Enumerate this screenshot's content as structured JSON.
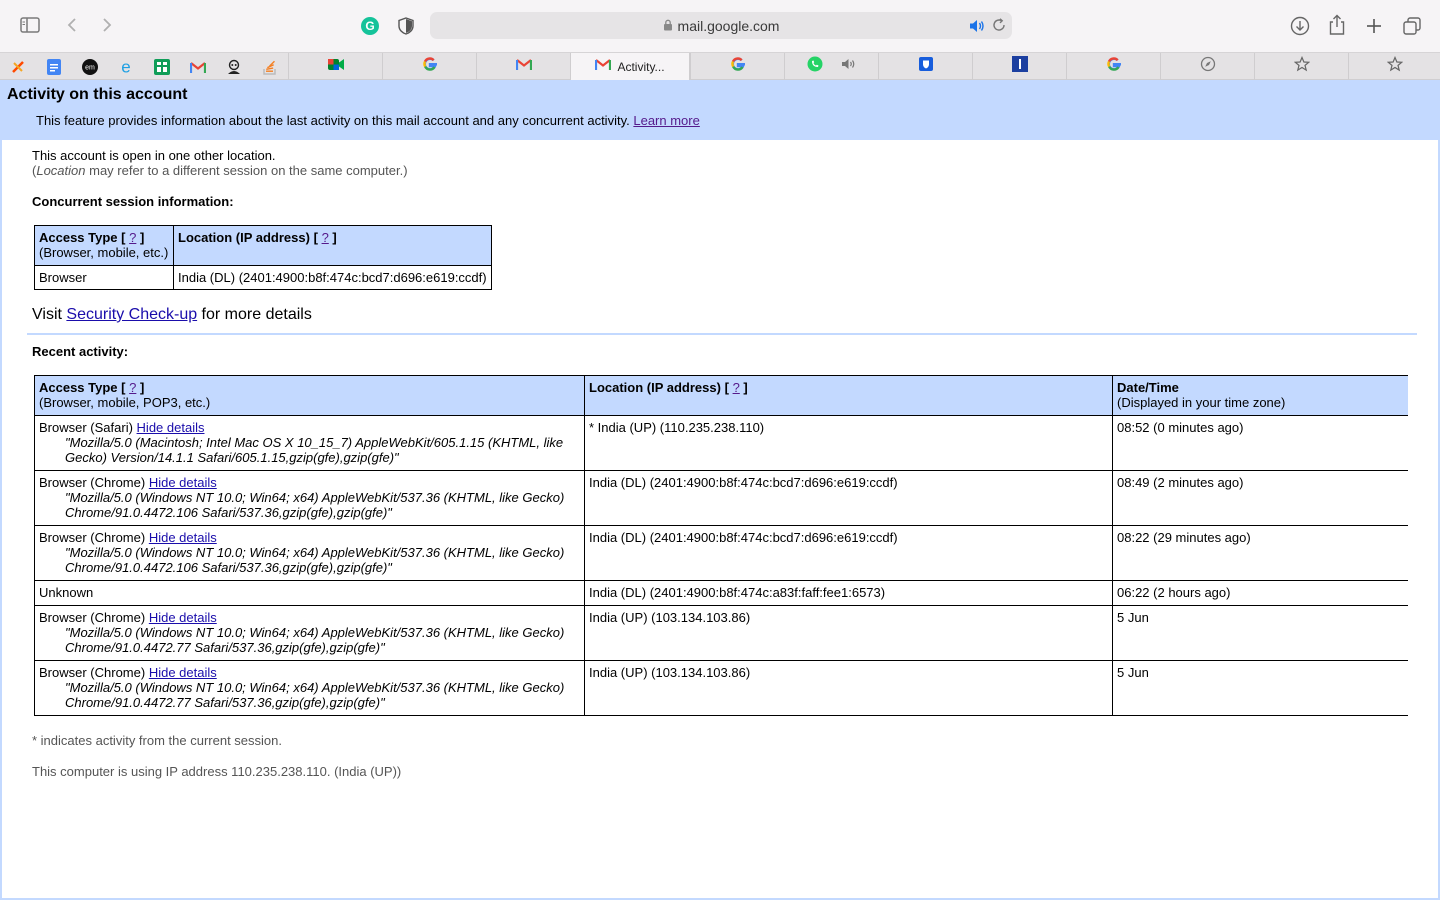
{
  "browser": {
    "url": "mail.google.com",
    "active_tab_title": "Activity...",
    "accent": "#1a73e8"
  },
  "page": {
    "title": "Activity on this account",
    "intro": "This feature provides information about the last activity on this mail account and any concurrent activity.",
    "learn_more": "Learn more",
    "open_status": "This account is open in one other location.",
    "location_note_pre": "(",
    "location_note_em": "Location",
    "location_note_post": " may refer to a different session on the same computer.)",
    "concurrent_heading": "Concurrent session information:",
    "visit_pre": "Visit ",
    "security_link": "Security Check-up",
    "visit_post": " for more details",
    "recent_heading": "Recent activity:",
    "footnote_current": "* indicates activity from the current session.",
    "footnote_ip": "This computer is using IP address 110.235.238.110. (India (UP))",
    "help_mark": "?",
    "bracket_open": "[",
    "bracket_close": "]"
  },
  "concurrent_table": {
    "col1_title": "Access Type",
    "col1_sub": "(Browser, mobile, etc.)",
    "col2_title": "Location (IP address)",
    "rows": [
      {
        "access": "Browser",
        "location": "India (DL) (2401:4900:b8f:474c:bcd7:d696:e619:ccdf)"
      }
    ]
  },
  "recent_table": {
    "col1_title": "Access Type",
    "col1_sub": "(Browser, mobile, POP3, etc.)",
    "col2_title": "Location (IP address)",
    "col3_title": "Date/Time",
    "col3_sub": "(Displayed in your time zone)",
    "hide_details": "Hide details",
    "rows": [
      {
        "access": "Browser (Safari)",
        "details": true,
        "ua": "\"Mozilla/5.0 (Macintosh; Intel Mac OS X 10_15_7) AppleWebKit/605.1.15 (KHTML, like Gecko) Version/14.1.1 Safari/605.1.15,gzip(gfe),gzip(gfe)\"",
        "location": "* India (UP) (110.235.238.110)",
        "time": "08:52 (0 minutes ago)"
      },
      {
        "access": "Browser (Chrome)",
        "details": true,
        "ua": "\"Mozilla/5.0 (Windows NT 10.0; Win64; x64) AppleWebKit/537.36 (KHTML, like Gecko) Chrome/91.0.4472.106 Safari/537.36,gzip(gfe),gzip(gfe)\"",
        "location": "India (DL) (2401:4900:b8f:474c:bcd7:d696:e619:ccdf)",
        "time": "08:49 (2 minutes ago)"
      },
      {
        "access": "Browser (Chrome)",
        "details": true,
        "ua": "\"Mozilla/5.0 (Windows NT 10.0; Win64; x64) AppleWebKit/537.36 (KHTML, like Gecko) Chrome/91.0.4472.106 Safari/537.36,gzip(gfe),gzip(gfe)\"",
        "location": "India (DL) (2401:4900:b8f:474c:bcd7:d696:e619:ccdf)",
        "time": "08:22 (29 minutes ago)"
      },
      {
        "access": "Unknown",
        "details": false,
        "ua": "",
        "location": "India (DL) (2401:4900:b8f:474c:a83f:faff:fee1:6573)",
        "time": "06:22 (2 hours ago)"
      },
      {
        "access": "Browser (Chrome)",
        "details": true,
        "ua": "\"Mozilla/5.0 (Windows NT 10.0; Win64; x64) AppleWebKit/537.36 (KHTML, like Gecko) Chrome/91.0.4472.77 Safari/537.36,gzip(gfe),gzip(gfe)\"",
        "location": "India (UP) (103.134.103.86)",
        "time": "5 Jun"
      },
      {
        "access": "Browser (Chrome)",
        "details": true,
        "ua": "\"Mozilla/5.0 (Windows NT 10.0; Win64; x64) AppleWebKit/537.36 (KHTML, like Gecko) Chrome/91.0.4472.77 Safari/537.36,gzip(gfe),gzip(gfe)\"",
        "location": "India (UP) (103.134.103.86)",
        "time": "5 Jun"
      }
    ]
  },
  "icons": {
    "toolbar": [
      "sidebar-icon",
      "back-icon",
      "forward-icon",
      "grammarly-icon",
      "shield-icon",
      "lock-icon",
      "speaker-icon",
      "reload-icon",
      "download-icon",
      "share-icon",
      "new-tab-icon",
      "tab-overview-icon"
    ],
    "pinned_tabs": [
      "zapier-icon",
      "google-docs-icon",
      "em-icon",
      "edge-icon",
      "google-sheets-icon",
      "gmail-icon",
      "incognito-icon",
      "stackoverflow-icon"
    ],
    "tabs": [
      "google-meet-icon",
      "google-icon",
      "gmail-icon",
      "gmail-icon",
      "google-icon",
      "whatsapp-icon",
      "bitwarden-icon",
      "instapaper-icon",
      "google-icon",
      "compass-icon",
      "star-icon",
      "star-icon"
    ]
  }
}
